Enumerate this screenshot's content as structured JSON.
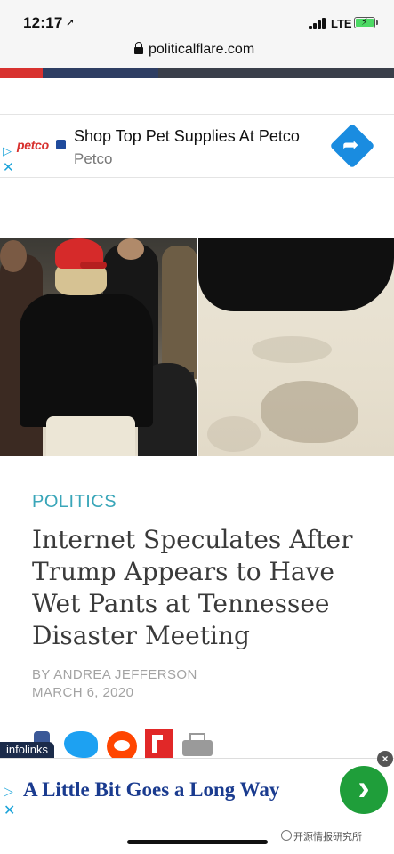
{
  "status_bar": {
    "time": "12:17",
    "location_glyph": "➚",
    "network": "LTE",
    "battery_charging": true
  },
  "browser": {
    "url": "politicalflare.com",
    "secure": true
  },
  "top_ad": {
    "choice_glyph": "▷",
    "close_glyph": "✕",
    "brand_logo": "petco",
    "headline": "Shop Top Pet Supplies At Petco",
    "advertiser": "Petco",
    "cta_glyph": "➦",
    "cta_color": "#1a8ce0"
  },
  "article": {
    "category": "POLITICS",
    "title": "Internet Speculates After Trump Appears to Have Wet Pants at Tennessee Disaster Meeting",
    "byline": "BY ANDREA JEFFERSON",
    "date": "MARCH 6, 2020"
  },
  "share": {
    "infolinks": "infolinks",
    "icons": [
      "facebook-icon",
      "twitter-icon",
      "reddit-icon",
      "flipboard-icon",
      "print-icon"
    ]
  },
  "bottom_ad": {
    "choice_glyph": "▷",
    "close_glyph": "✕",
    "dismiss_glyph": "×",
    "headline": "A Little Bit Goes a Long Way",
    "cta_glyph": "›",
    "cta_color": "#1f9e3a"
  },
  "watermark": {
    "text": "开源情报研究所"
  },
  "colors": {
    "category": "#3aa6b9",
    "accent_red": "#d8322f",
    "accent_blue": "#2e3e63"
  }
}
